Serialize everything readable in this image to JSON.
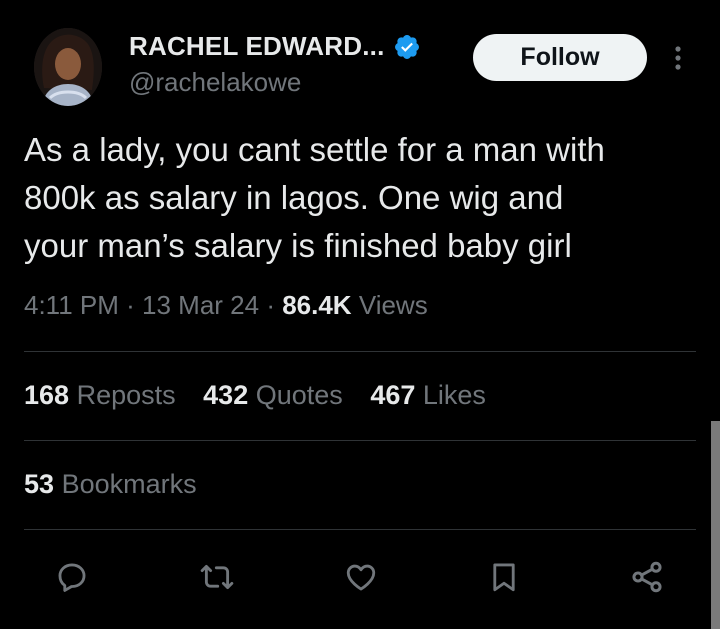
{
  "author": {
    "display_name": "RACHEL EDWARD...",
    "handle": "@rachelakowe",
    "avatar_icon": "profile-photo",
    "verified_icon": "verified-badge-icon",
    "verified_color": "#1d9bf0"
  },
  "header": {
    "follow_label": "Follow",
    "more_icon": "more-vertical-icon"
  },
  "tweet": {
    "lines": [
      "As a lady, you cant settle for a man with",
      "800k as salary in lagos. One wig and",
      "your man’s salary is finished baby girl"
    ]
  },
  "meta": {
    "time": "4:11 PM",
    "sep1": " · ",
    "date": "13 Mar 24",
    "sep2": " · ",
    "views_count": "86.4K",
    "views_label": "Views"
  },
  "stats": {
    "reposts_count": "168",
    "reposts_label": "Reposts",
    "quotes_count": "432",
    "quotes_label": "Quotes",
    "likes_count": "467",
    "likes_label": "Likes",
    "bookmarks_count": "53",
    "bookmarks_label": "Bookmarks"
  },
  "actions": [
    "reply-icon",
    "repost-icon",
    "like-icon",
    "bookmark-icon",
    "share-icon"
  ],
  "colors": {
    "background": "#000000",
    "text_primary": "#e7e9ea",
    "text_secondary": "#71767b",
    "divider": "#2f3336",
    "follow_bg": "#eff3f4"
  }
}
